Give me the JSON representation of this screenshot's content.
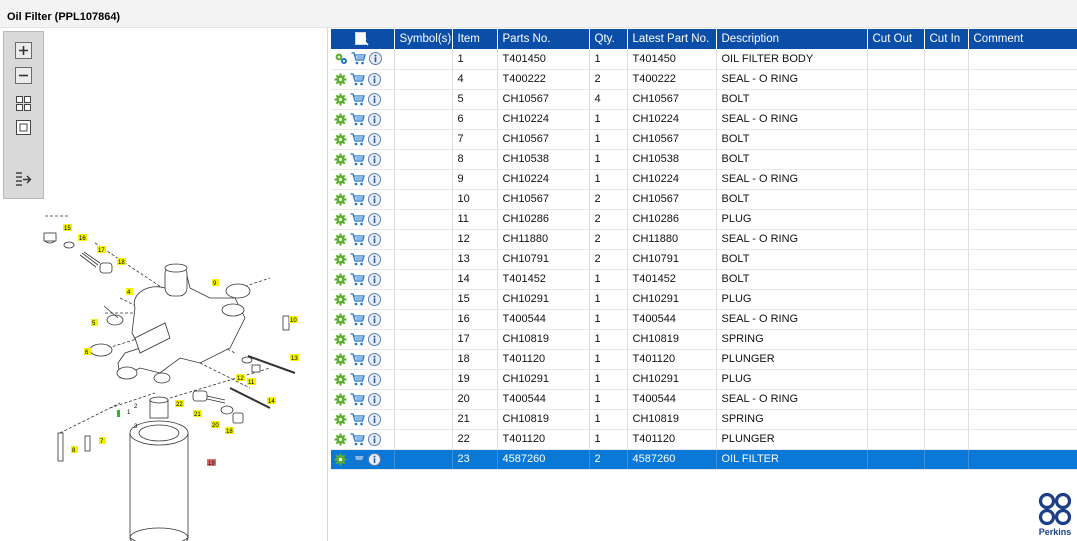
{
  "window": {
    "title": "Oil Filter (PPL107864)"
  },
  "toolbar": {
    "buttons": [
      {
        "name": "zoom-in",
        "icon": "zoom-in-icon"
      },
      {
        "name": "zoom-out",
        "icon": "zoom-out-icon"
      },
      {
        "name": "fit-all",
        "icon": "fit-all-icon"
      },
      {
        "name": "actual-size",
        "icon": "actual-size-icon"
      },
      {
        "name": "export",
        "icon": "export-icon"
      }
    ]
  },
  "diagram": {
    "callouts": [
      "15",
      "16",
      "17",
      "18",
      "4",
      "9",
      "5",
      "10",
      "6",
      "13",
      "12",
      "11",
      "22",
      "21",
      "14",
      "20",
      "18",
      "8",
      "7",
      "19"
    ],
    "parts_labels": [
      "1",
      "2",
      "3"
    ]
  },
  "grid": {
    "columns": [
      "",
      "Symbol(s)",
      "Item",
      "Parts No.",
      "Qty.",
      "Latest Part No.",
      "Description",
      "Cut Out",
      "Cut In",
      "Comment"
    ],
    "rows": [
      {
        "item": "1",
        "part": "T401450",
        "qty": "1",
        "latest": "T401450",
        "desc": "OIL FILTER BODY",
        "selected": false,
        "multi": true
      },
      {
        "item": "4",
        "part": "T400222",
        "qty": "2",
        "latest": "T400222",
        "desc": "SEAL - O RING",
        "selected": false,
        "multi": false
      },
      {
        "item": "5",
        "part": "CH10567",
        "qty": "4",
        "latest": "CH10567",
        "desc": "BOLT",
        "selected": false,
        "multi": false
      },
      {
        "item": "6",
        "part": "CH10224",
        "qty": "1",
        "latest": "CH10224",
        "desc": "SEAL - O RING",
        "selected": false,
        "multi": false
      },
      {
        "item": "7",
        "part": "CH10567",
        "qty": "1",
        "latest": "CH10567",
        "desc": "BOLT",
        "selected": false,
        "multi": false
      },
      {
        "item": "8",
        "part": "CH10538",
        "qty": "1",
        "latest": "CH10538",
        "desc": "BOLT",
        "selected": false,
        "multi": false
      },
      {
        "item": "9",
        "part": "CH10224",
        "qty": "1",
        "latest": "CH10224",
        "desc": "SEAL - O RING",
        "selected": false,
        "multi": false
      },
      {
        "item": "10",
        "part": "CH10567",
        "qty": "2",
        "latest": "CH10567",
        "desc": "BOLT",
        "selected": false,
        "multi": false
      },
      {
        "item": "11",
        "part": "CH10286",
        "qty": "2",
        "latest": "CH10286",
        "desc": "PLUG",
        "selected": false,
        "multi": false
      },
      {
        "item": "12",
        "part": "CH11880",
        "qty": "2",
        "latest": "CH11880",
        "desc": "SEAL - O RING",
        "selected": false,
        "multi": false
      },
      {
        "item": "13",
        "part": "CH10791",
        "qty": "2",
        "latest": "CH10791",
        "desc": "BOLT",
        "selected": false,
        "multi": false
      },
      {
        "item": "14",
        "part": "T401452",
        "qty": "1",
        "latest": "T401452",
        "desc": "BOLT",
        "selected": false,
        "multi": false
      },
      {
        "item": "15",
        "part": "CH10291",
        "qty": "1",
        "latest": "CH10291",
        "desc": "PLUG",
        "selected": false,
        "multi": false
      },
      {
        "item": "16",
        "part": "T400544",
        "qty": "1",
        "latest": "T400544",
        "desc": "SEAL - O RING",
        "selected": false,
        "multi": false
      },
      {
        "item": "17",
        "part": "CH10819",
        "qty": "1",
        "latest": "CH10819",
        "desc": "SPRING",
        "selected": false,
        "multi": false
      },
      {
        "item": "18",
        "part": "T401120",
        "qty": "1",
        "latest": "T401120",
        "desc": "PLUNGER",
        "selected": false,
        "multi": false
      },
      {
        "item": "19",
        "part": "CH10291",
        "qty": "1",
        "latest": "CH10291",
        "desc": "PLUG",
        "selected": false,
        "multi": false
      },
      {
        "item": "20",
        "part": "T400544",
        "qty": "1",
        "latest": "T400544",
        "desc": "SEAL - O RING",
        "selected": false,
        "multi": false
      },
      {
        "item": "21",
        "part": "CH10819",
        "qty": "1",
        "latest": "CH10819",
        "desc": "SPRING",
        "selected": false,
        "multi": false
      },
      {
        "item": "22",
        "part": "T401120",
        "qty": "1",
        "latest": "T401120",
        "desc": "PLUNGER",
        "selected": false,
        "multi": false
      },
      {
        "item": "23",
        "part": "4587260",
        "qty": "2",
        "latest": "4587260",
        "desc": "OIL FILTER",
        "selected": true,
        "multi": false
      }
    ]
  },
  "icons": {
    "header": "find-in-diagram-icon",
    "row": [
      "gear-icon",
      "shopping-cart-icon",
      "info-icon"
    ]
  },
  "colors": {
    "header_bg": "#0b4ea8",
    "selected_row": "#0a78d7",
    "gear_green": "#5cae2e",
    "cart_blue": "#1f6fc5",
    "callout_yellow": "#f4f400",
    "callout_red": "#e07070"
  },
  "brand": {
    "logo_text": "Perkins"
  }
}
